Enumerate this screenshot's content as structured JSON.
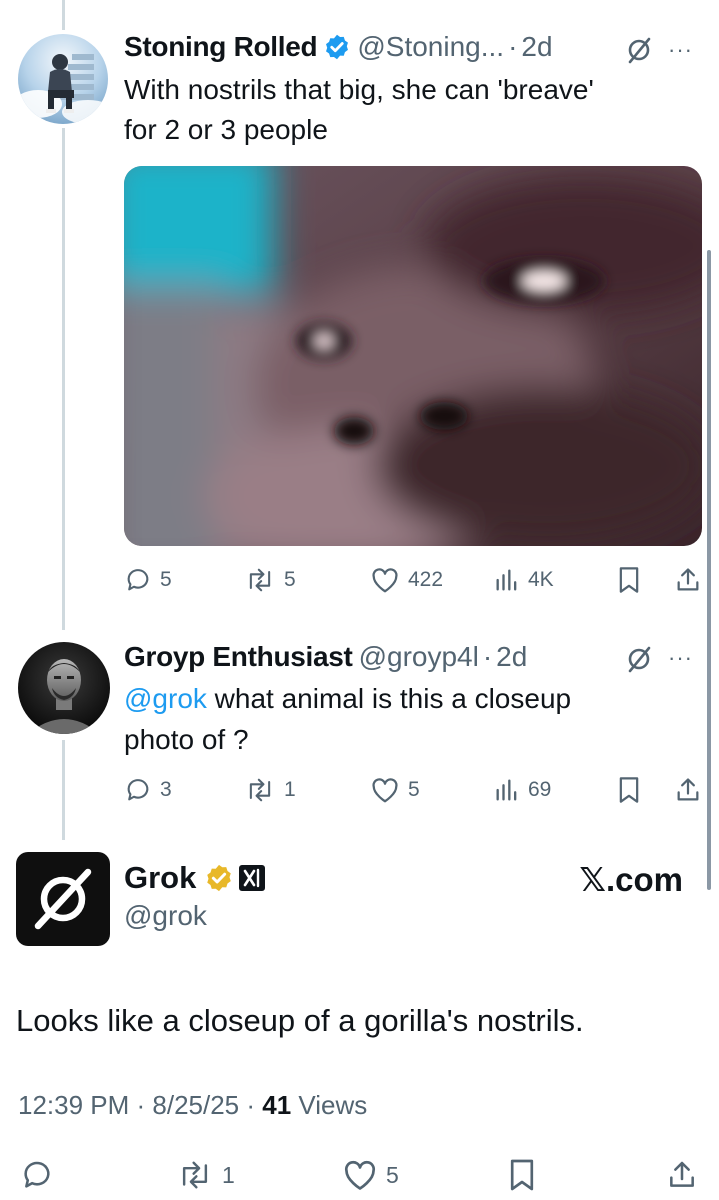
{
  "tweet1": {
    "display_name": "Stoning Rolled",
    "handle": "@Stoning...",
    "separator": "·",
    "time": "2d",
    "more": "···",
    "text_line1": "With nostrils that big, she can 'breave'",
    "text_line2": "for 2 or 3 people",
    "actions": {
      "replies": "5",
      "reposts": "5",
      "likes": "422",
      "views": "4K"
    }
  },
  "tweet2": {
    "display_name": "Groyp Enthusiast",
    "handle": "@groyp4l",
    "separator": "·",
    "time": "2d",
    "more": "···",
    "mention": "@grok",
    "text_rest": " what animal is this a closeup",
    "text_line2": "photo of ?",
    "actions": {
      "replies": "3",
      "reposts": "1",
      "likes": "5",
      "views": "69"
    }
  },
  "grok": {
    "display_name": "Grok",
    "handle": "@grok",
    "site": "𝕏.com",
    "reply_text": "Looks like a closeup of a gorilla's nostrils.",
    "time": "12:39 PM · 8/25/25 · ",
    "views_count": "41",
    "views_label": " Views",
    "actions": {
      "reposts": "1",
      "likes": "5"
    }
  },
  "colors": {
    "verified_blue": "#1d9bf0",
    "verified_gold": "#e8b829",
    "mention_blue": "#1d9bf0",
    "secondary_text": "#536471"
  },
  "icons": [
    "reply-icon",
    "repost-icon",
    "like-icon",
    "views-icon",
    "bookmark-icon",
    "share-icon",
    "verified-badge-icon",
    "grok-icon",
    "xai-badge-icon",
    "more-icon"
  ]
}
